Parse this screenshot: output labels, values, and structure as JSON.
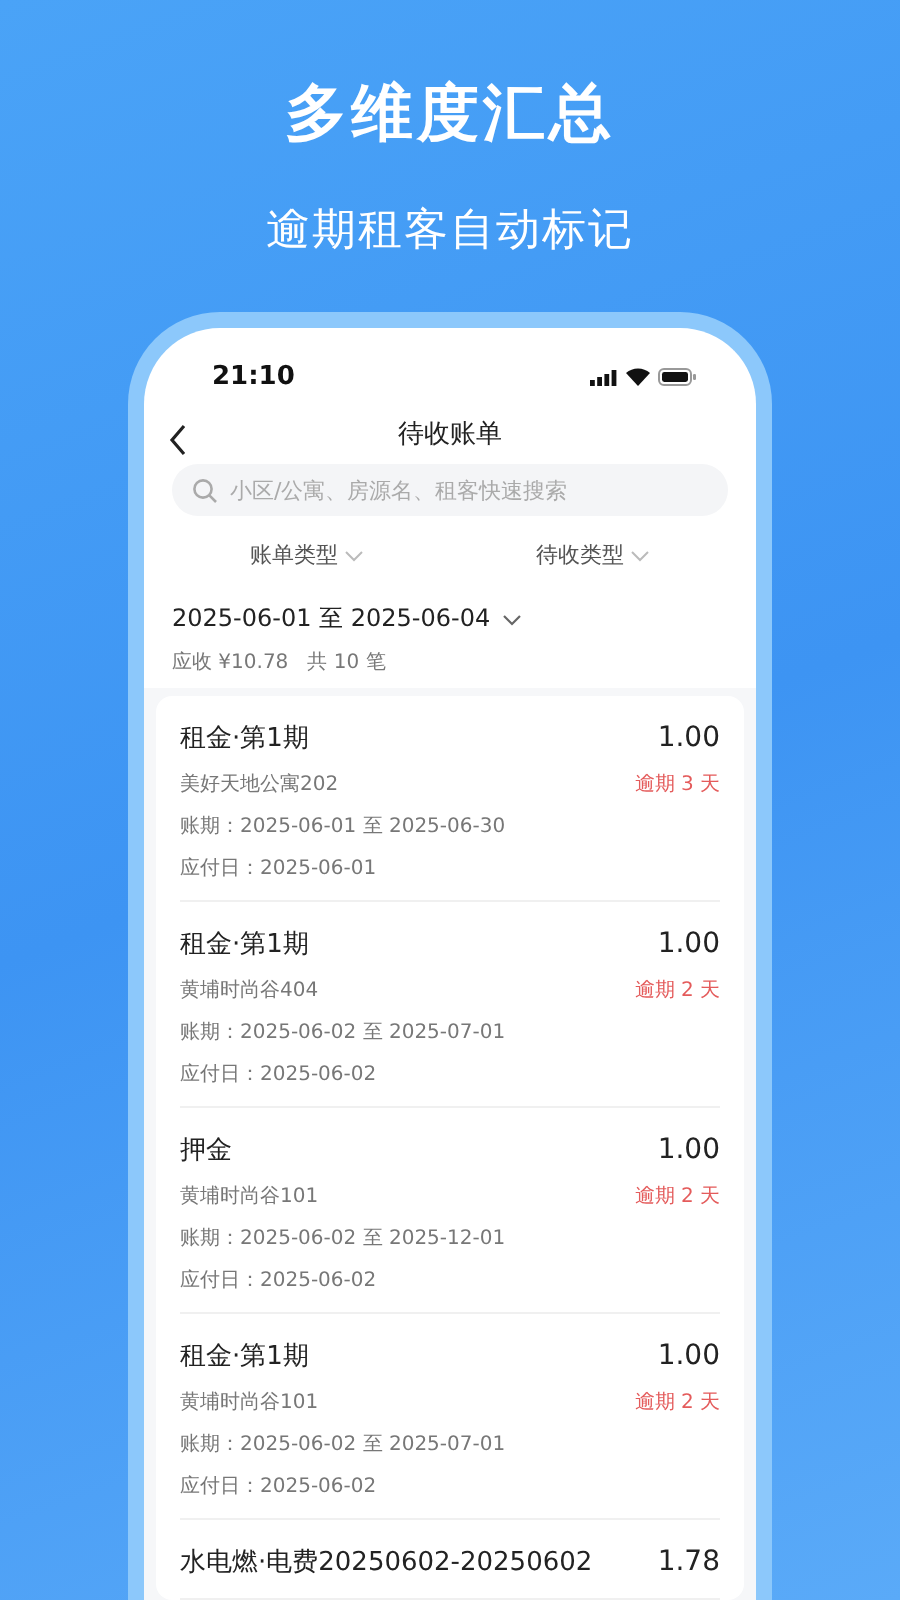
{
  "headline": "多维度汇总",
  "subheadline": "逾期租客自动标记",
  "status_bar": {
    "time": "21:10"
  },
  "nav": {
    "title": "待收账单"
  },
  "search": {
    "placeholder": "小区/公寓、房源名、租客快速搜索"
  },
  "filters": [
    {
      "label": "账单类型"
    },
    {
      "label": "待收类型"
    }
  ],
  "date_range": {
    "label": "2025-06-01 至 2025-06-04"
  },
  "summary": "应收 ¥10.78   共 10 笔",
  "bills": [
    {
      "title": "租金·第1期",
      "amount": "1.00",
      "property": "美好天地公寓202",
      "overdue": "逾期 3 天",
      "period": "账期：2025-06-01 至 2025-06-30",
      "due": "应付日：2025-06-01"
    },
    {
      "title": "租金·第1期",
      "amount": "1.00",
      "property": "黄埔时尚谷404",
      "overdue": "逾期 2 天",
      "period": "账期：2025-06-02 至 2025-07-01",
      "due": "应付日：2025-06-02"
    },
    {
      "title": "押金",
      "amount": "1.00",
      "property": "黄埔时尚谷101",
      "overdue": "逾期 2 天",
      "period": "账期：2025-06-02 至 2025-12-01",
      "due": "应付日：2025-06-02"
    },
    {
      "title": "租金·第1期",
      "amount": "1.00",
      "property": "黄埔时尚谷101",
      "overdue": "逾期 2 天",
      "period": "账期：2025-06-02 至 2025-07-01",
      "due": "应付日：2025-06-02"
    },
    {
      "title": "水电燃·电费20250602-20250602",
      "amount": "1.78"
    }
  ]
}
